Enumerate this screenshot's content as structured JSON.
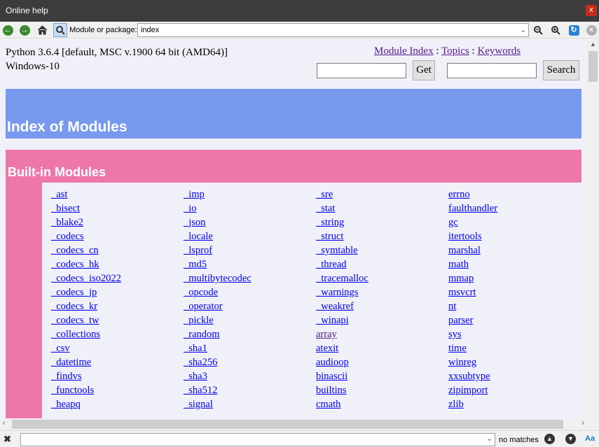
{
  "window": {
    "title": "Online help",
    "close_glyph": "x"
  },
  "toolbar": {
    "module_label": "Module or package:",
    "module_value": "index",
    "icons": [
      "back-icon",
      "forward-icon",
      "home-icon",
      "search-icon",
      "zoom-out-icon",
      "zoom-in-icon",
      "refresh-icon",
      "stop-icon"
    ]
  },
  "page": {
    "python_version": "Python 3.6.4 [default, MSC v.1900 64 bit (AMD64)]",
    "os": "Windows-10",
    "links": {
      "module_index": "Module Index",
      "sep1": " : ",
      "topics": "Topics",
      "sep2": " : ",
      "keywords": "Keywords"
    },
    "get_button": "Get",
    "search_button": "Search",
    "heading": "Index of Modules",
    "section_title": "Built-in Modules",
    "columns": [
      [
        "_ast",
        "_bisect",
        "_blake2",
        "_codecs",
        "_codecs_cn",
        "_codecs_hk",
        "_codecs_iso2022",
        "_codecs_jp",
        "_codecs_kr",
        "_codecs_tw",
        "_collections",
        "_csv",
        "_datetime",
        "_findvs",
        "_functools",
        "_heapq"
      ],
      [
        "_imp",
        "_io",
        "_json",
        "_locale",
        "_lsprof",
        "_md5",
        "_multibytecodec",
        "_opcode",
        "_operator",
        "_pickle",
        "_random",
        "_sha1",
        "_sha256",
        "_sha3",
        "_sha512",
        "_signal"
      ],
      [
        "_sre",
        "_stat",
        "_string",
        "_struct",
        "_symtable",
        "_thread",
        "_tracemalloc",
        "_warnings",
        "_weakref",
        "_winapi",
        "array",
        "atexit",
        "audioop",
        "binascii",
        "builtins",
        "cmath"
      ],
      [
        "errno",
        "faulthandler",
        "gc",
        "itertools",
        "marshal",
        "math",
        "mmap",
        "msvcrt",
        "nt",
        "parser",
        "sys",
        "time",
        "winreg",
        "xxsubtype",
        "zipimport",
        "zlib"
      ]
    ],
    "visited": [
      "array"
    ]
  },
  "colors": {
    "heading_band": "#7799ee",
    "section_band": "#ee77aa",
    "link": "#0000ee",
    "visited_link": "#551a8b"
  },
  "findbar": {
    "status": "no matches",
    "case_label": "Aa"
  }
}
